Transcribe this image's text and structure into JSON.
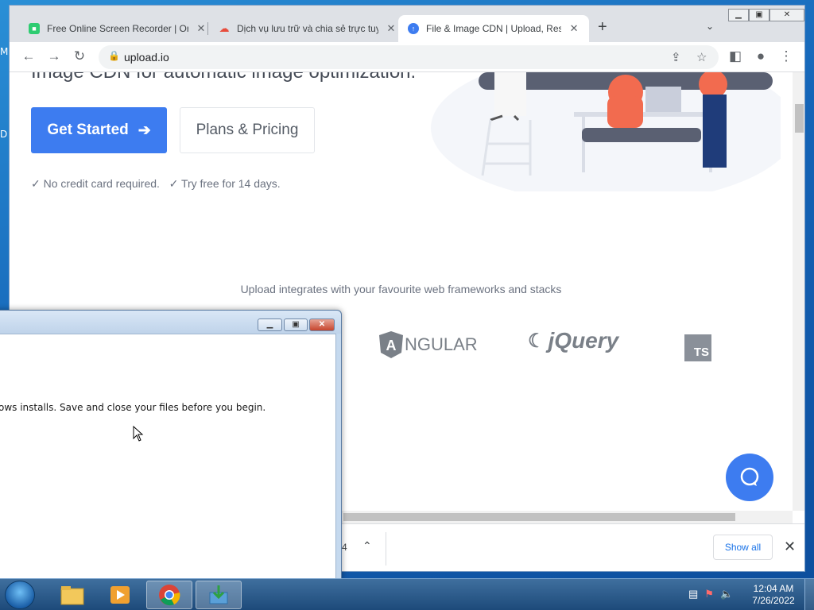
{
  "desktop": {
    "labels": [
      "M",
      "D"
    ]
  },
  "browser": {
    "tabs": [
      {
        "title": "Free Online Screen Recorder | Or",
        "favicon": "screen-recorder-icon",
        "color": "#2ecc71"
      },
      {
        "title": "Dịch vụ lưu trữ và chia sẻ trực tuy",
        "favicon": "cloud-icon",
        "color": "#e74c3c"
      },
      {
        "title": "File & Image CDN | Upload, Resiz",
        "favicon": "upload-icon",
        "color": "#3d7cf0",
        "active": true
      }
    ],
    "new_tab": "+",
    "address": {
      "url": "upload.io"
    }
  },
  "page": {
    "headline": "Image CDN for automatic image optimization.",
    "get_started": "Get Started",
    "plans_pricing": "Plans & Pricing",
    "notes": "✓ No credit card required.   ✓ Try free for 14 days.",
    "integrations_text": "Upload integrates with your favourite web frameworks and stacks",
    "logos": {
      "angular": "NGULAR",
      "jquery": "jQuery",
      "ts": "TS"
    }
  },
  "downloads": {
    "count": "4",
    "show_all": "Show all"
  },
  "dialog": {
    "message": "ows installs. Save and close your files before you begin."
  },
  "taskbar": {
    "time": "12:04 AM",
    "date": "7/26/2022"
  }
}
